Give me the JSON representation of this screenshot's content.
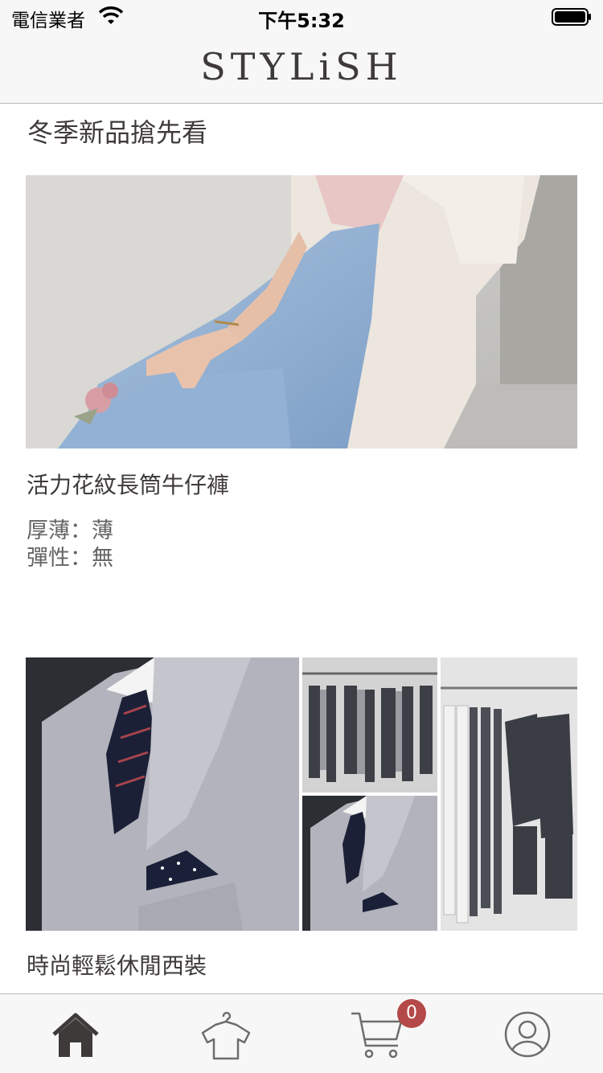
{
  "status_bar": {
    "carrier": "電信業者",
    "time": "下午5:32"
  },
  "nav": {
    "logo": "STYLiSH"
  },
  "section": {
    "title": "冬季新品搶先看"
  },
  "products": [
    {
      "title": "活力花紋長筒牛仔褲",
      "details": [
        "厚薄：薄",
        "彈性：無"
      ]
    },
    {
      "title": "時尚輕鬆休閒西裝"
    }
  ],
  "tabbar": {
    "items": [
      {
        "icon": "home-icon",
        "active": true
      },
      {
        "icon": "hanger-shirt-icon",
        "active": false
      },
      {
        "icon": "cart-icon",
        "active": false
      },
      {
        "icon": "profile-icon",
        "active": false
      }
    ],
    "cart_badge": "0"
  },
  "colors": {
    "accent": "#3f3a3a",
    "badge": "#b54848",
    "bar_bg": "#f7f7f7"
  }
}
